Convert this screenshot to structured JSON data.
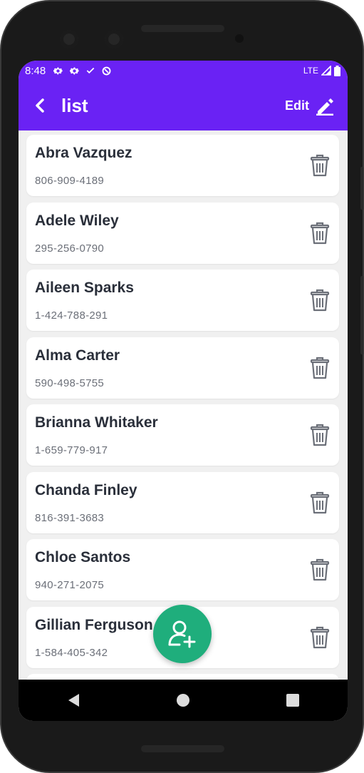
{
  "status_bar": {
    "time": "8:48",
    "network": "LTE",
    "icons": [
      "gear-icon",
      "gear-icon",
      "check-icon",
      "sync-icon"
    ]
  },
  "app_bar": {
    "title": "list",
    "edit_label": "Edit"
  },
  "contacts": [
    {
      "name": "Abra Vazquez",
      "phone": "806-909-4189"
    },
    {
      "name": "Adele Wiley",
      "phone": "295-256-0790"
    },
    {
      "name": "Aileen Sparks",
      "phone": "1-424-788-291"
    },
    {
      "name": "Alma Carter",
      "phone": "590-498-5755"
    },
    {
      "name": "Brianna Whitaker",
      "phone": "1-659-779-917"
    },
    {
      "name": "Chanda Finley",
      "phone": "816-391-3683"
    },
    {
      "name": "Chloe Santos",
      "phone": "940-271-2075"
    },
    {
      "name": "Gillian Ferguson",
      "phone": "1-584-405-342"
    }
  ],
  "colors": {
    "primary": "#6a22f4",
    "fab": "#1fae7c",
    "background": "#f0f0f0",
    "name_text": "#2a2f3a",
    "phone_text": "#6b6f78"
  }
}
